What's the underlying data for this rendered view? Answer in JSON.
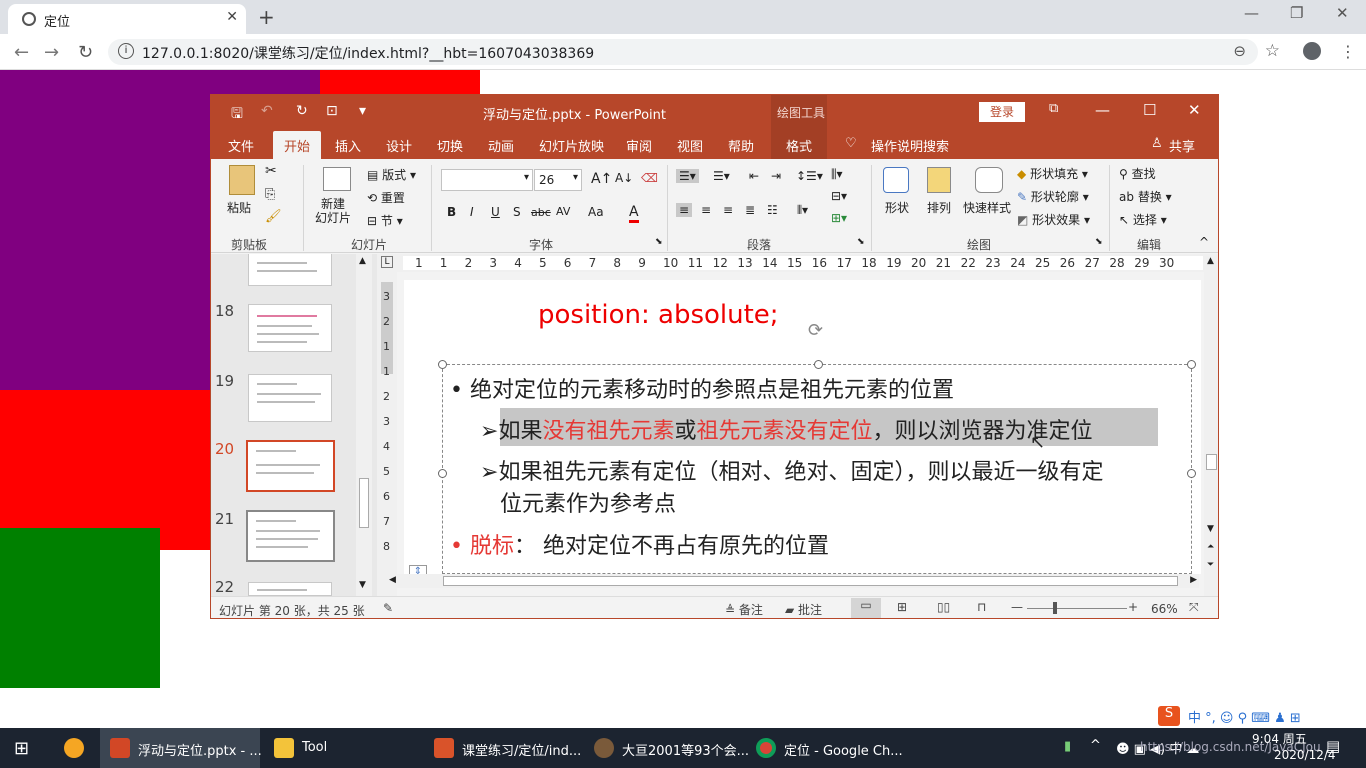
{
  "browser": {
    "tab_title": "定位",
    "url": "127.0.0.1:8020/课堂练习/定位/index.html?__hbt=1607043038369"
  },
  "powerpoint": {
    "window_title": "浮动与定位.pptx  -  PowerPoint",
    "drawing_tools": "绘图工具",
    "login": "登录",
    "tabs": [
      "文件",
      "开始",
      "插入",
      "设计",
      "切换",
      "动画",
      "幻灯片放映",
      "审阅",
      "视图",
      "帮助",
      "格式"
    ],
    "tell_me": "操作说明搜索",
    "share": "共享",
    "groups": {
      "clipboard": "剪贴板",
      "slides": "幻灯片",
      "font": "字体",
      "paragraph": "段落",
      "drawing": "绘图",
      "editing": "编辑"
    },
    "buttons": {
      "paste": "粘贴",
      "new_slide": "新建\n幻灯片",
      "layout": "版式",
      "reset": "重置",
      "section": "节",
      "shape": "形状",
      "arrange": "排列",
      "quick_styles": "快速样式",
      "shape_fill": "形状填充",
      "shape_outline": "形状轮廓",
      "shape_effects": "形状效果",
      "find": "查找",
      "replace": "替换",
      "select": "选择"
    },
    "font_size": "26",
    "font_btns": [
      "B",
      "I",
      "U",
      "S",
      "abc",
      "AV",
      "Aa",
      "A"
    ],
    "slide_numbers": [
      "18",
      "19",
      "20",
      "21",
      "22"
    ],
    "ruler_h": [
      "1",
      "1",
      "2",
      "3",
      "4",
      "5",
      "6",
      "7",
      "8",
      "9",
      "10",
      "11",
      "12",
      "13",
      "14",
      "15",
      "16",
      "17",
      "18",
      "19",
      "20",
      "21",
      "22",
      "23",
      "24",
      "25",
      "26",
      "27",
      "28",
      "29",
      "30"
    ],
    "ruler_v": [
      "3",
      "2",
      "1",
      "1",
      "2",
      "3",
      "4",
      "5",
      "6",
      "7",
      "8"
    ],
    "slide": {
      "heading": "position: absolute;",
      "b1": "绝对定位的元素移动时的参照点是祖先元素的位置",
      "b2_a": "如果",
      "b2_b": "没有祖先元素",
      "b2_c": "或",
      "b2_d": "祖先元素没有定位",
      "b2_e": "，则以浏览器为准定位",
      "b3_1": "如果祖先元素有定位（相对、绝对、固定），则以最近一级有定",
      "b3_2": "位元素作为参考点",
      "b4_a": "脱标",
      "b4_b": "：  绝对定位不再占有原先的位置"
    },
    "status": {
      "slide_info": "幻灯片 第 20 张，共 25 张",
      "notes": "备注",
      "comments": "批注",
      "zoom": "66%"
    }
  },
  "taskbar": {
    "items": [
      "浮动与定位.pptx - ...",
      "Tool",
      "课堂练习/定位/ind...",
      "大亘2001等93个会...",
      "定位 - Google Ch..."
    ],
    "time": "9:04 周五",
    "date": "2020/12/4",
    "watermark": "https://blog.csdn.net/JavaCJou"
  },
  "colors": {
    "ppt_accent": "#b7472a",
    "purple": "#800080",
    "red": "#ff0000",
    "green": "#008000"
  }
}
